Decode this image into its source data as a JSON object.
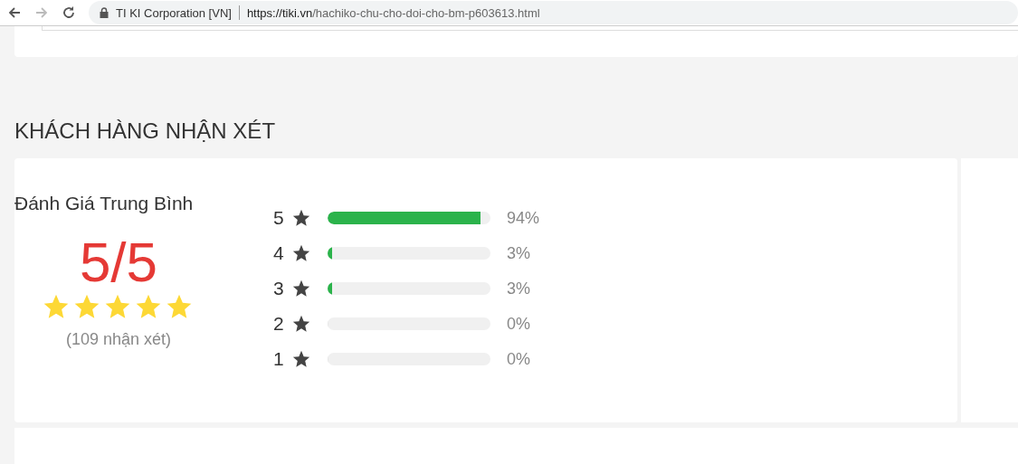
{
  "browser": {
    "site_name": "TI KI Corporation [VN]",
    "url_domain": "https://tiki.vn",
    "url_path": "/hachiko-chu-cho-doi-cho-bm-p603613.html"
  },
  "reviews": {
    "heading": "KHÁCH HÀNG NHẬN XÉT",
    "average_label": "Đánh Giá Trung Bình",
    "average_score": "5/5",
    "stars": 5,
    "count": "(109 nhận xét)",
    "breakdown": [
      {
        "rating": "5",
        "level": 0.94,
        "percent": "94%"
      },
      {
        "rating": "4",
        "level": 0.03,
        "percent": "3%"
      },
      {
        "rating": "3",
        "level": 0.03,
        "percent": "3%"
      },
      {
        "rating": "2",
        "level": 0,
        "percent": "0%"
      },
      {
        "rating": "1",
        "level": 0,
        "percent": "0%"
      }
    ]
  }
}
